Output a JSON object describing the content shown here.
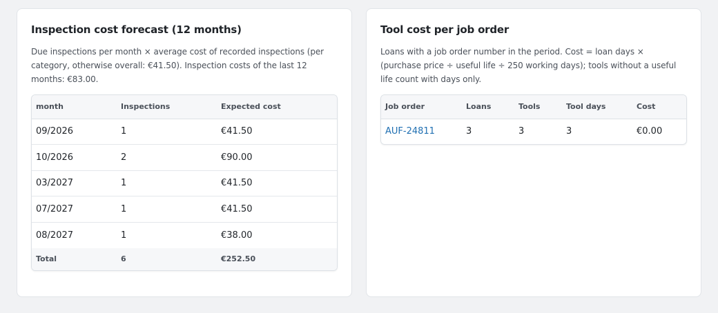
{
  "forecast": {
    "title": "Inspection cost forecast (12 months)",
    "description": "Due inspections per month × average cost of recorded inspections (per category, otherwise overall: €41.50). Inspection costs of the last 12 months: €83.00.",
    "columns": [
      "month",
      "Inspections",
      "Expected cost"
    ],
    "rows": [
      {
        "month": "09/2026",
        "inspections": "1",
        "cost": "€41.50"
      },
      {
        "month": "10/2026",
        "inspections": "2",
        "cost": "€90.00"
      },
      {
        "month": "03/2027",
        "inspections": "1",
        "cost": "€41.50"
      },
      {
        "month": "07/2027",
        "inspections": "1",
        "cost": "€41.50"
      },
      {
        "month": "08/2027",
        "inspections": "1",
        "cost": "€38.00"
      }
    ],
    "total": {
      "label": "Total",
      "inspections": "6",
      "cost": "€252.50"
    }
  },
  "tool_cost": {
    "title": "Tool cost per job order",
    "description": "Loans with a job order number in the period. Cost = loan days × (purchase price ÷ useful life ÷ 250 working days); tools without a useful life count with days only.",
    "columns": [
      "Job order",
      "Loans",
      "Tools",
      "Tool days",
      "Cost"
    ],
    "rows": [
      {
        "job_order": "AUF-24811",
        "loans": "3",
        "tools": "3",
        "tool_days": "3",
        "cost": "€0.00"
      }
    ]
  }
}
